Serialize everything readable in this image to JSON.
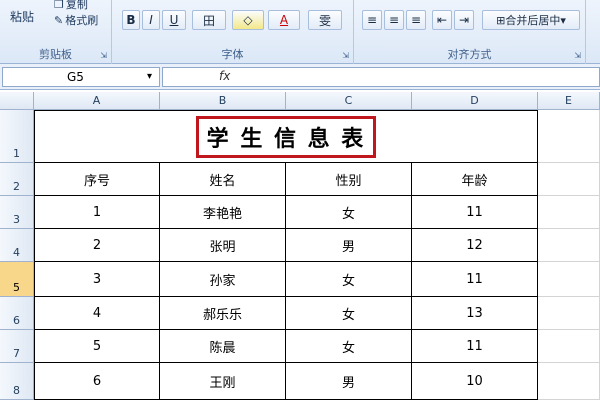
{
  "ribbon": {
    "clipboard": {
      "paste": "粘贴",
      "copy": "复制",
      "format_painter": "格式刷",
      "label": "剪贴板"
    },
    "font": {
      "bold": "B",
      "italic": "I",
      "underline": "U",
      "border": "田",
      "fill": "◇",
      "color": "A",
      "phonetic": "雯",
      "label": "字体"
    },
    "alignment": {
      "merge_center": "合并后居中",
      "label": "对齐方式"
    }
  },
  "formula_bar": {
    "name_box": "G5",
    "fx": "fx",
    "value": ""
  },
  "columns": [
    "A",
    "B",
    "C",
    "D",
    "E"
  ],
  "rows": [
    "1",
    "2",
    "3",
    "4",
    "5",
    "6",
    "7",
    "8"
  ],
  "selected_row": "5",
  "title": "学 生 信 息 表",
  "headers": [
    "序号",
    "姓名",
    "性别",
    "年龄"
  ],
  "data": [
    [
      "1",
      "李艳艳",
      "女",
      "11"
    ],
    [
      "2",
      "张明",
      "男",
      "12"
    ],
    [
      "3",
      "孙家",
      "女",
      "11"
    ],
    [
      "4",
      "郝乐乐",
      "女",
      "13"
    ],
    [
      "5",
      "陈晨",
      "女",
      "11"
    ],
    [
      "6",
      "王刚",
      "男",
      "10"
    ]
  ],
  "colors": {
    "title_border": "#c0161d",
    "selected_row": "#f8d78a"
  }
}
